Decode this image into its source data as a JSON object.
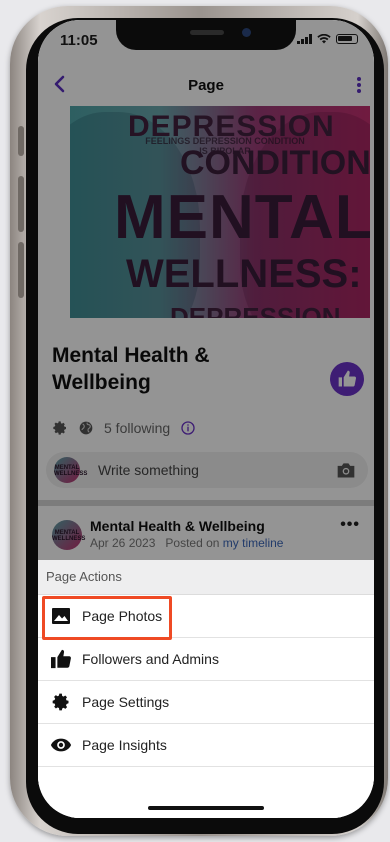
{
  "status": {
    "time": "11:05"
  },
  "nav": {
    "title": "Page"
  },
  "cover": {
    "word1": "DEPRESSION",
    "small_text": "FEELINGS DEPRESSION CONDITION IS BIPOLAR",
    "word2": "CONDITION",
    "word3": "MENTAL",
    "word4": "WELLNESS:",
    "word5": "DEPRESSION"
  },
  "profile": {
    "name": "Mental Health & Wellbeing",
    "following": "5 following"
  },
  "composer": {
    "placeholder": "Write something"
  },
  "avatar_text": "MENTAL WELLNESS",
  "post": {
    "author": "Mental Health & Wellbeing",
    "date": "Apr 26 2023",
    "posted_on": "Posted on",
    "timeline_link": "my timeline"
  },
  "sheet": {
    "header": "Page Actions",
    "items": [
      {
        "label": "Page Photos",
        "icon": "photo-icon"
      },
      {
        "label": "Followers and Admins",
        "icon": "thumbs-up-icon"
      },
      {
        "label": "Page Settings",
        "icon": "gear-icon"
      },
      {
        "label": "Page Insights",
        "icon": "eye-icon"
      }
    ]
  },
  "colors": {
    "accent": "#6b33c9",
    "highlight": "#ef4a24",
    "link": "#3b67b8"
  }
}
